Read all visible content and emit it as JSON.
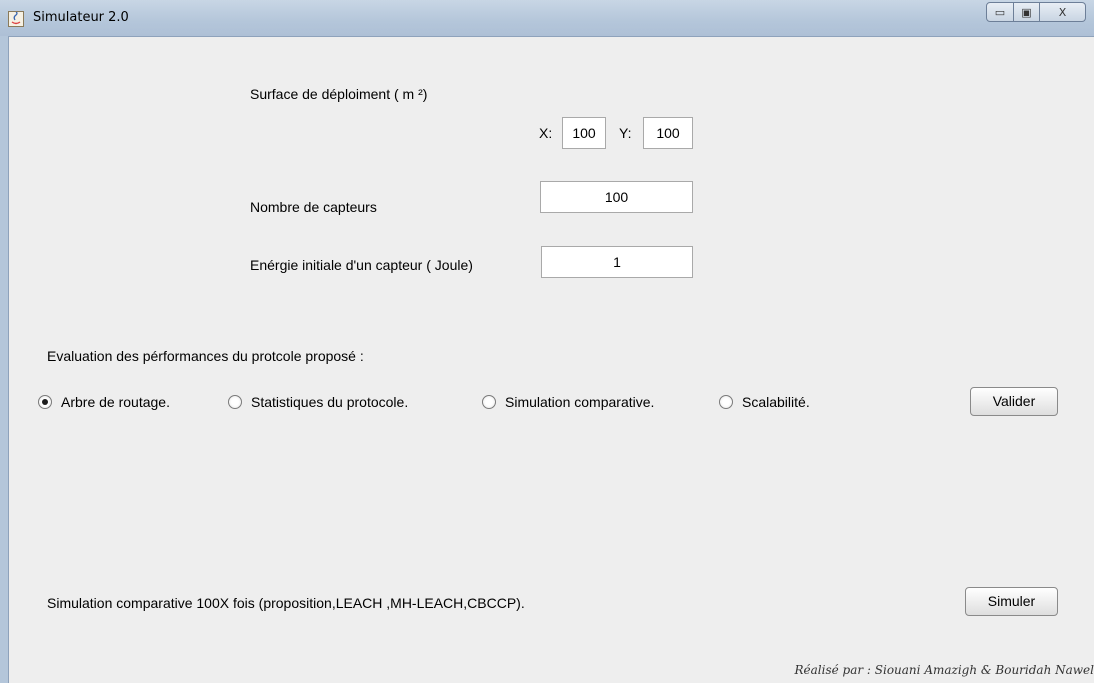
{
  "window": {
    "title": "Simulateur 2.0",
    "controls": {
      "minimize": "▭",
      "maximize": "▣",
      "close": "X"
    }
  },
  "deployment": {
    "title": "Surface de déploiment  ( m ²)",
    "x_label": "X:",
    "x_value": "100",
    "y_label": "Y:",
    "y_value": "100"
  },
  "sensors": {
    "label": "Nombre de capteurs",
    "value": "100"
  },
  "energy": {
    "label": "Enérgie initiale d'un capteur ( Joule)",
    "value": "1"
  },
  "evaluation": {
    "heading": "Evaluation des pérformances du protcole proposé :",
    "options": [
      {
        "label": "Arbre de routage.",
        "checked": true
      },
      {
        "label": "Statistiques du protocole.",
        "checked": false
      },
      {
        "label": "Simulation comparative.",
        "checked": false
      },
      {
        "label": "Scalabilité.",
        "checked": false
      }
    ],
    "validate_label": "Valider"
  },
  "simulation": {
    "label": "Simulation comparative 100X fois (proposition,LEACH ,MH-LEACH,CBCCP).",
    "button_label": "Simuler"
  },
  "footer": {
    "credits": "Réalisé par : Siouani Amazigh & Bouridah Nawel"
  }
}
